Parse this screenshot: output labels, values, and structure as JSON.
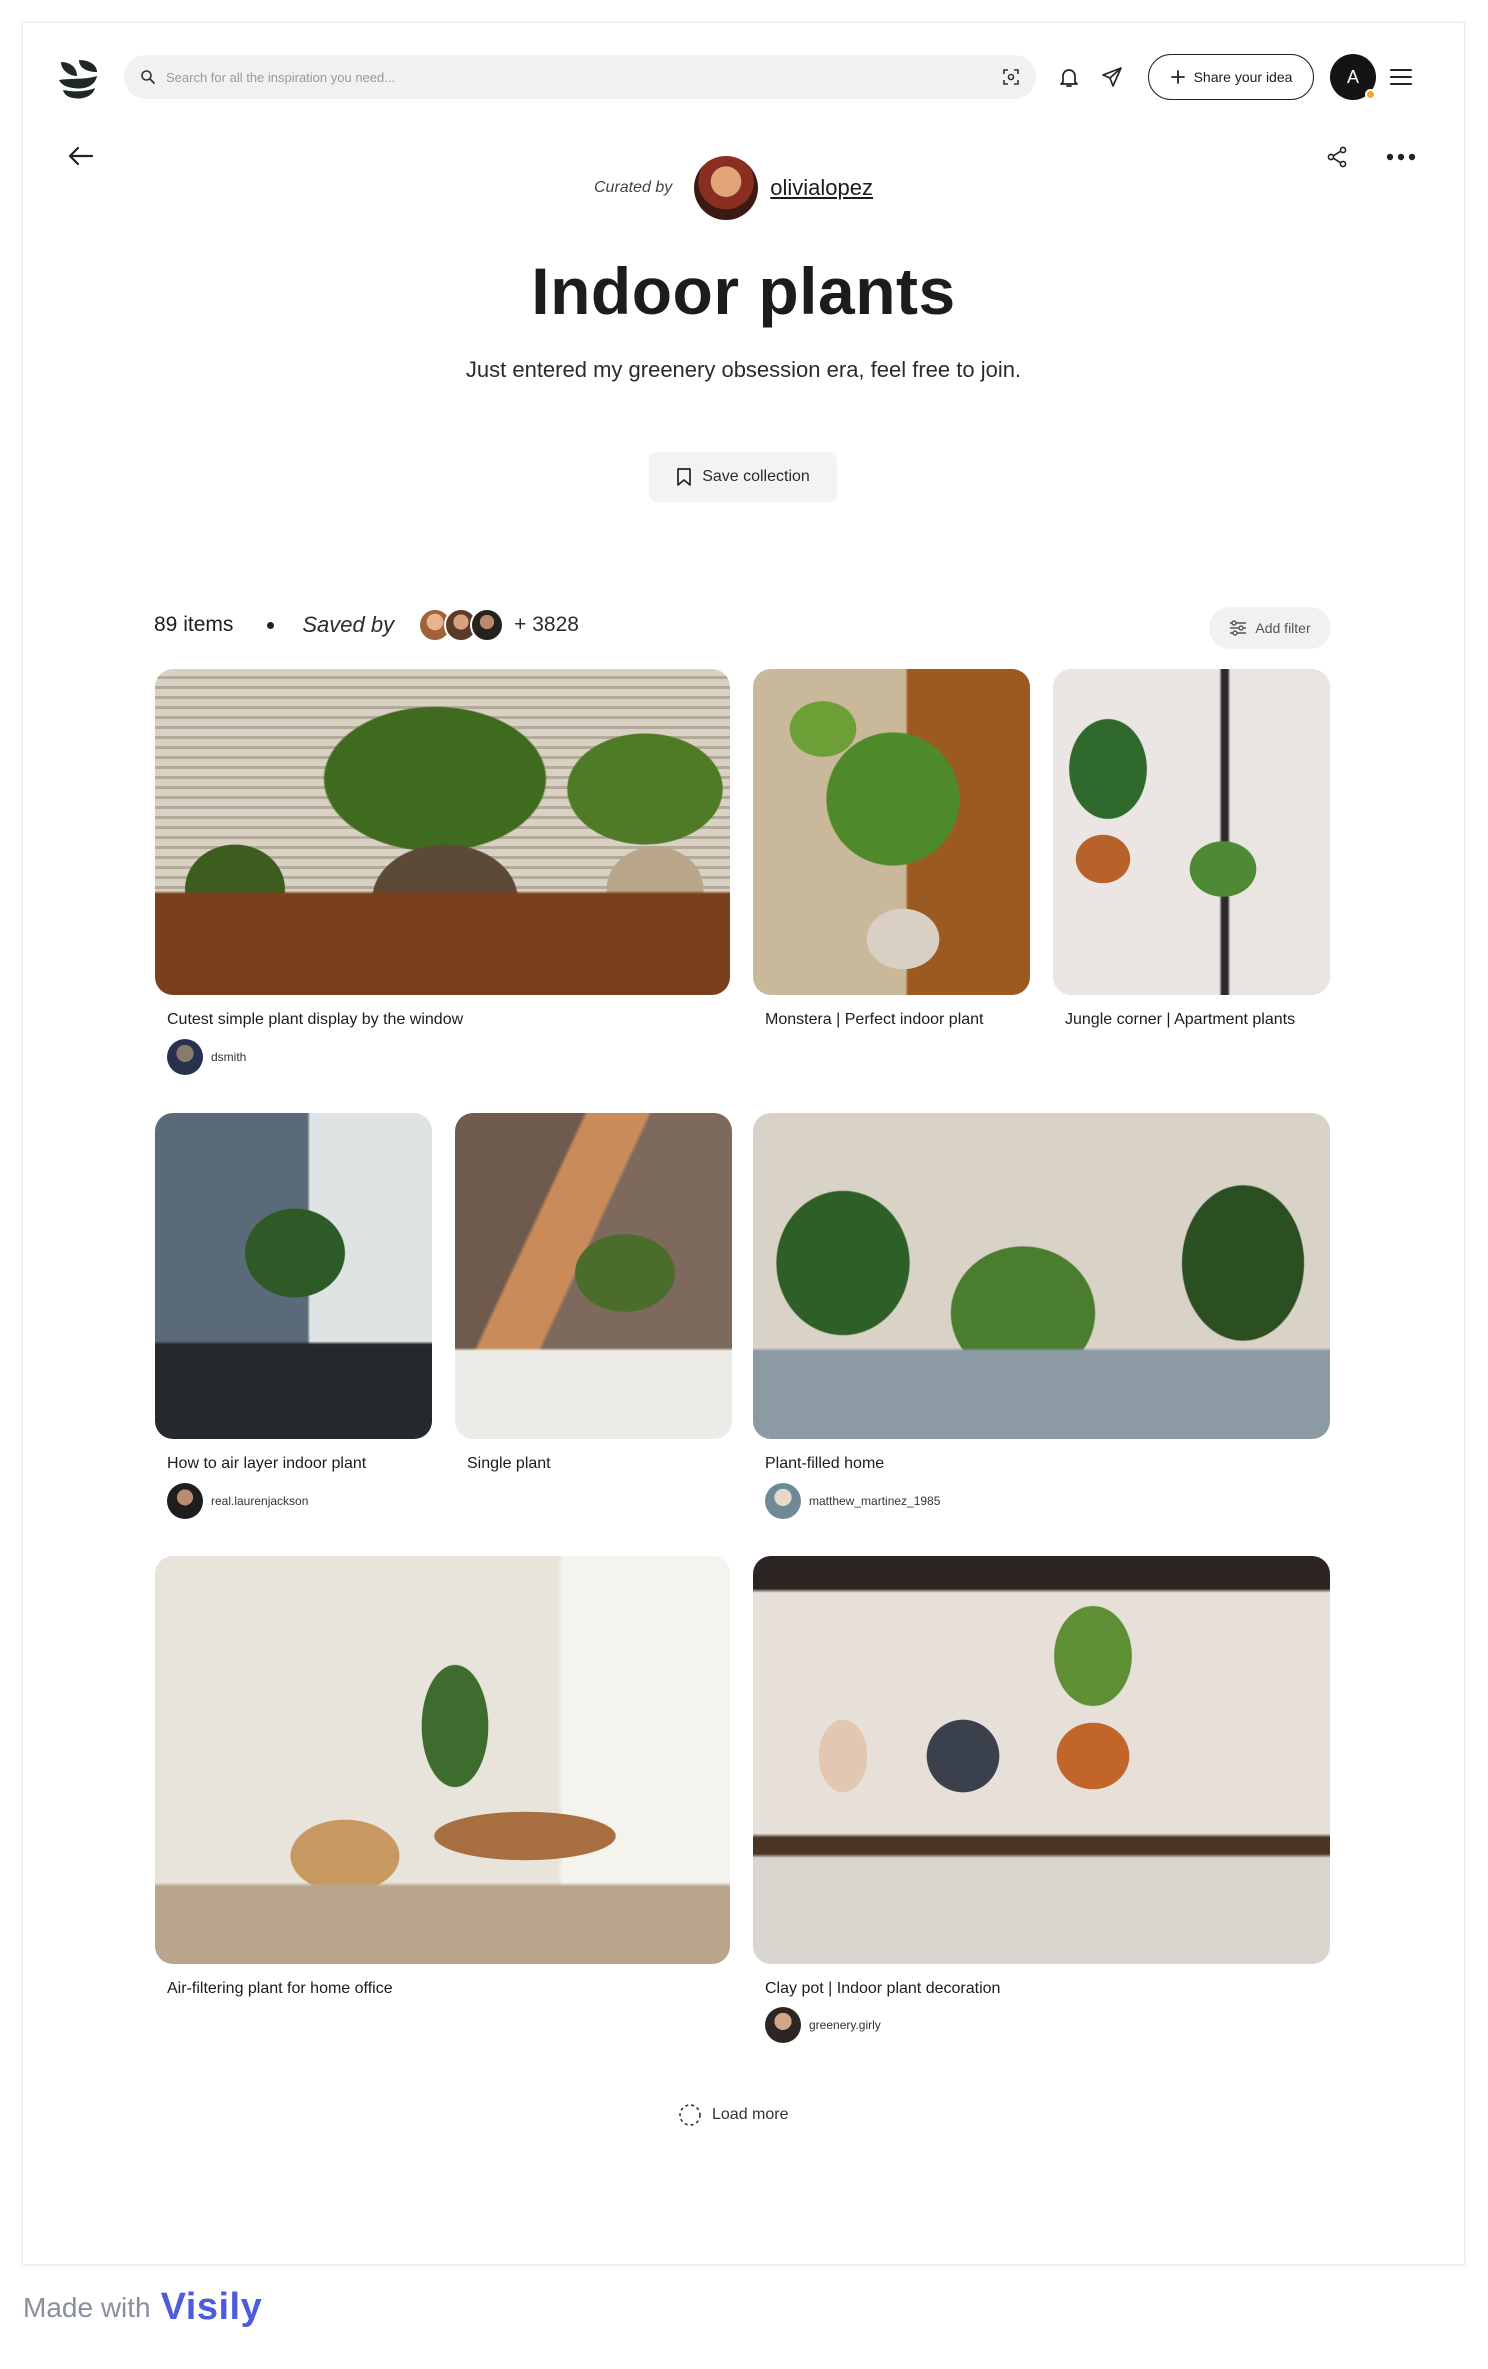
{
  "header": {
    "search_placeholder": "Search for all the inspiration you need...",
    "share_idea_label": "Share your idea",
    "avatar_letter": "A"
  },
  "collection": {
    "curated_label": "Curated by",
    "curator": "olivialopez",
    "title": "Indoor plants",
    "description": "Just entered my greenery obsession era, feel free to join.",
    "save_label": "Save collection",
    "item_count": "89 items",
    "saved_by_label": "Saved by",
    "saved_by_more": "+ 3828",
    "add_filter_label": "Add filter"
  },
  "items": [
    {
      "caption": "Cutest simple plant display by the window",
      "user": "dsmith"
    },
    {
      "caption": "Monstera | Perfect indoor plant",
      "user": ""
    },
    {
      "caption": "Jungle corner | Apartment plants",
      "user": ""
    },
    {
      "caption": "How to air layer indoor plant",
      "user": "real.laurenjackson"
    },
    {
      "caption": "Single plant",
      "user": ""
    },
    {
      "caption": "Plant-filled home",
      "user": "matthew_martinez_1985"
    },
    {
      "caption": "Air-filtering plant for home office",
      "user": ""
    },
    {
      "caption": "Clay pot | Indoor plant decoration",
      "user": "greenery.girly"
    }
  ],
  "load_more_label": "Load more",
  "footer": {
    "made_with": "Made with",
    "brand": "Visily"
  },
  "colors": {
    "accent_brand": "#4d5bdc",
    "notification_dot": "#f5a623"
  }
}
